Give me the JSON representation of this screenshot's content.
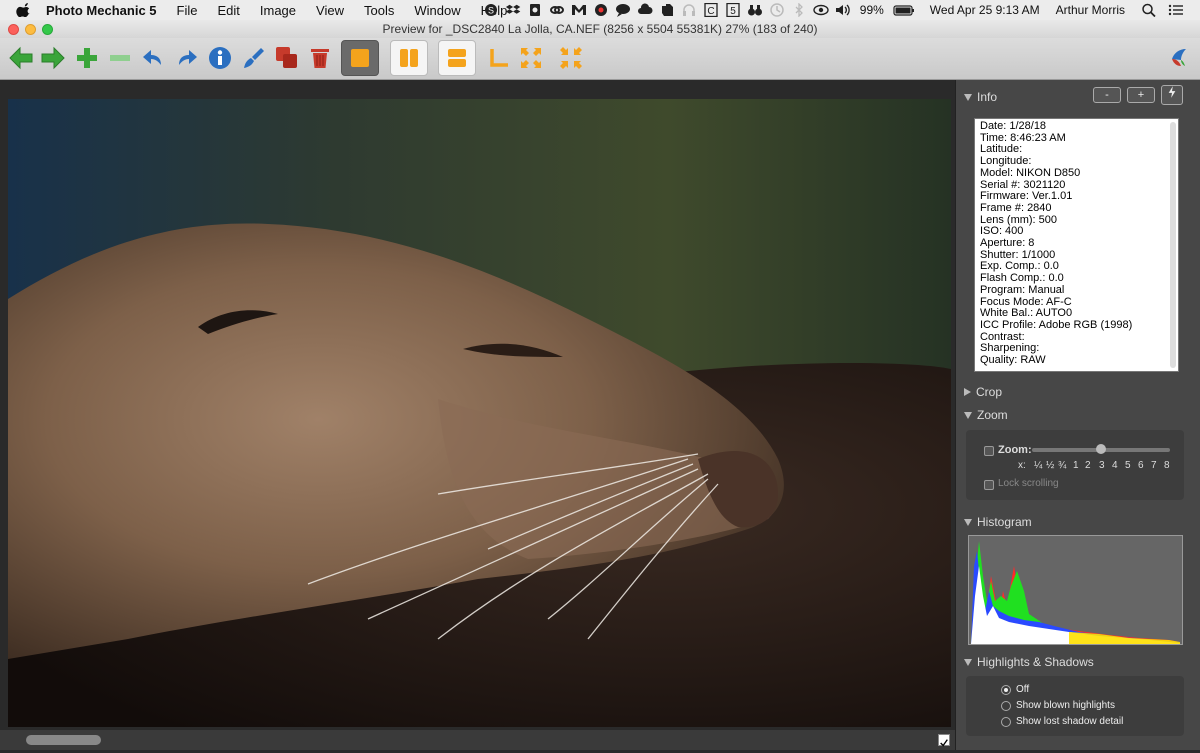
{
  "menubar": {
    "app_name": "Photo Mechanic 5",
    "menus": [
      "File",
      "Edit",
      "Image",
      "View",
      "Tools",
      "Window",
      "Help"
    ],
    "battery": "99%",
    "clock": "Wed Apr 25  9:13 AM",
    "user": "Arthur Morris"
  },
  "window": {
    "title": "Preview for _DSC2840  La  Jolla, CA.NEF (8256 x 5504 55381K) 27% (183 of 240)"
  },
  "toolbar": {
    "icons": [
      "back-arrow-icon",
      "forward-arrow-icon",
      "add-icon",
      "remove-icon",
      "undo-icon",
      "redo-icon",
      "info-icon",
      "color-class-icon",
      "copy-icon",
      "trash-icon",
      "single-view-icon",
      "two-up-vertical-icon",
      "two-up-horizontal-icon",
      "crop-icon",
      "fit-zoom-icon",
      "actual-size-icon"
    ]
  },
  "panel": {
    "info": {
      "title": "Info",
      "minus_label": "-",
      "plus_label": "+",
      "lines": [
        "Date: 1/28/18",
        "Time: 8:46:23 AM",
        "Latitude:",
        "Longitude:",
        "Model: NIKON D850",
        "Serial #: 3021120",
        "Firmware: Ver.1.01",
        "Frame #: 2840",
        "Lens (mm): 500",
        "ISO: 400",
        "Aperture: 8",
        "Shutter: 1/1000",
        "Exp. Comp.: 0.0",
        "Flash Comp.: 0.0",
        "Program: Manual",
        "Focus Mode: AF-C",
        "White Bal.: AUTO0",
        "ICC Profile: Adobe RGB (1998)",
        "Contrast:",
        "Sharpening:",
        "Quality: RAW"
      ]
    },
    "crop": {
      "title": "Crop"
    },
    "zoom": {
      "title": "Zoom",
      "zoom_label": "Zoom:",
      "scale_prefix": "x:",
      "scale": [
        "¼",
        "½",
        "¾",
        "1",
        "2",
        "3",
        "4",
        "5",
        "6",
        "7",
        "8"
      ],
      "lock_label": "Lock scrolling"
    },
    "histogram": {
      "title": "Histogram"
    },
    "highlights": {
      "title": "Highlights & Shadows",
      "options": [
        "Off",
        "Show blown highlights",
        "Show lost shadow detail"
      ],
      "selected": "Off"
    }
  }
}
